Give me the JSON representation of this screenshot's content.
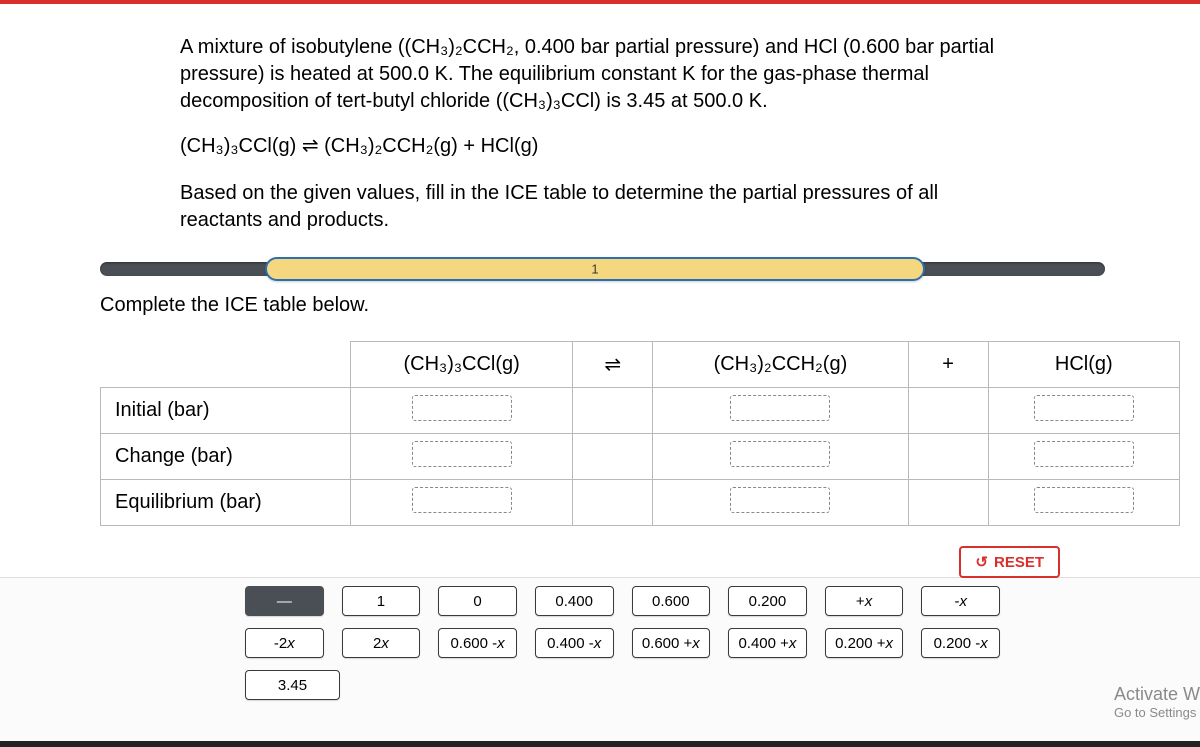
{
  "problem": {
    "p1": "A mixture of isobutylene ((CH₃)₂CCH₂, 0.400 bar partial pressure) and HCl (0.600 bar partial pressure) is heated at 500.0 K. The equilibrium constant K for the gas-phase thermal decomposition of tert-butyl chloride ((CH₃)₃CCl) is 3.45 at 500.0 K.",
    "equation": "(CH₃)₃CCl(g) ⇌ (CH₃)₂CCH₂(g) + HCl(g)",
    "p2": "Based on the given values, fill in the ICE table to determine the partial pressures of all reactants and products."
  },
  "progress": {
    "step": "1"
  },
  "sub_instruction": "Complete the ICE table below.",
  "table": {
    "head": {
      "c1": "(CH₃)₃CCl(g)",
      "op1": "⇌",
      "c2": "(CH₃)₂CCH₂(g)",
      "op2": "+",
      "c3": "HCl(g)"
    },
    "rows": {
      "r1": "Initial (bar)",
      "r2": "Change (bar)",
      "r3": "Equilibrium (bar)"
    }
  },
  "reset": {
    "label": "RESET"
  },
  "tiles": {
    "row1": [
      "—",
      "1",
      "0",
      "0.400",
      "0.600",
      "0.200",
      "+x",
      "-x"
    ],
    "row2": [
      "-2x",
      "2x",
      "0.600 - x",
      "0.400 - x",
      "0.600 + x",
      "0.400 + x",
      "0.200 + x",
      "0.200 - x"
    ],
    "row3": [
      "3.45"
    ]
  },
  "watermark": {
    "line1": "Activate W",
    "line2": "Go to Settings"
  }
}
